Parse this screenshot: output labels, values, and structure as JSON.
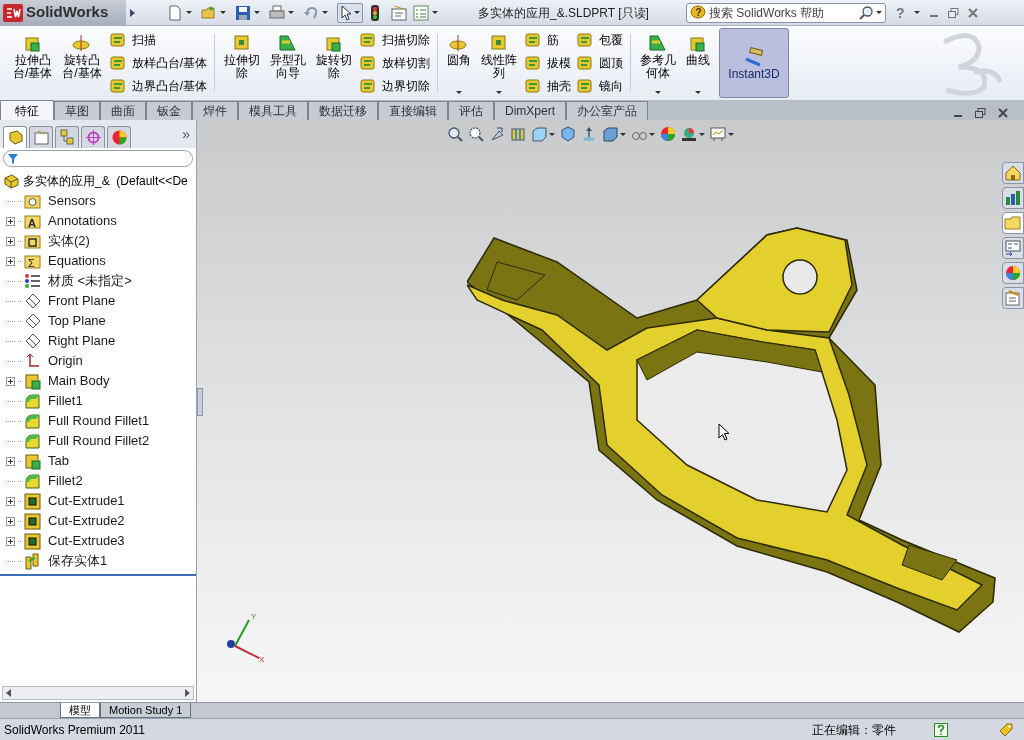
{
  "app": {
    "logo": "SolidWorks",
    "title": "多实体的应用_&.SLDPRT [只读]",
    "search": {
      "badge": "?",
      "placeholder": "搜索 SolidWorks 帮助"
    },
    "help": "?"
  },
  "ribbon": [
    {
      "kind": "large",
      "lines": [
        "拉伸凸",
        "台/基体"
      ],
      "dropdown": false,
      "selected": false
    },
    {
      "kind": "large",
      "lines": [
        "旋转凸",
        "台/基体"
      ],
      "dropdown": false,
      "selected": false
    },
    {
      "kind": "stack",
      "items": [
        "扫描",
        "放样凸台/基体",
        "边界凸台/基体"
      ]
    },
    {
      "kind": "separator"
    },
    {
      "kind": "large",
      "lines": [
        "拉伸切",
        "除"
      ],
      "dropdown": false,
      "selected": false
    },
    {
      "kind": "large",
      "lines": [
        "异型孔",
        "向导"
      ],
      "dropdown": false,
      "selected": false
    },
    {
      "kind": "large",
      "lines": [
        "旋转切",
        "除"
      ],
      "dropdown": false,
      "selected": false
    },
    {
      "kind": "stack",
      "items": [
        "扫描切除",
        "放样切割",
        "边界切除"
      ]
    },
    {
      "kind": "separator"
    },
    {
      "kind": "large",
      "lines": [
        "圆角"
      ],
      "dropdown": true,
      "selected": false
    },
    {
      "kind": "large",
      "lines": [
        "线性阵",
        "列"
      ],
      "dropdown": true,
      "selected": false
    },
    {
      "kind": "stack",
      "items": [
        "筋",
        "拔模",
        "抽壳"
      ]
    },
    {
      "kind": "stack",
      "items": [
        "包覆",
        "圆顶",
        "镜向"
      ]
    },
    {
      "kind": "separator"
    },
    {
      "kind": "large",
      "lines": [
        "参考几",
        "何体"
      ],
      "dropdown": true,
      "selected": false
    },
    {
      "kind": "large",
      "lines": [
        "曲线"
      ],
      "dropdown": true,
      "selected": false
    },
    {
      "kind": "large",
      "lines": [
        "Instant3D"
      ],
      "dropdown": false,
      "selected": true
    }
  ],
  "tabs": [
    {
      "label": "特征",
      "selected": true
    },
    {
      "label": "草图",
      "selected": false
    },
    {
      "label": "曲面",
      "selected": false
    },
    {
      "label": "钣金",
      "selected": false
    },
    {
      "label": "焊件",
      "selected": false
    },
    {
      "label": "模具工具",
      "selected": false
    },
    {
      "label": "数据迁移",
      "selected": false
    },
    {
      "label": "直接编辑",
      "selected": false
    },
    {
      "label": "评估",
      "selected": false
    },
    {
      "label": "DimXpert",
      "selected": false
    },
    {
      "label": "办公室产品",
      "selected": false
    }
  ],
  "panel": {
    "tabs": [
      {
        "selected": true
      },
      {
        "selected": false
      },
      {
        "selected": false
      },
      {
        "selected": false
      },
      {
        "selected": false
      }
    ],
    "more": "»",
    "tree": {
      "label": "多实体的应用_&  (Default<<De",
      "children": [
        {
          "label": "Sensors",
          "kind": "sensor",
          "expandable": false
        },
        {
          "label": "Annotations",
          "kind": "annotation",
          "badge": "A",
          "expandable": true
        },
        {
          "label": "实体(2)",
          "kind": "bodies",
          "expandable": true
        },
        {
          "label": "Equations",
          "kind": "equation",
          "badge": "Σ",
          "expandable": true
        },
        {
          "label": "材质 <未指定>",
          "kind": "material",
          "expandable": false
        },
        {
          "label": "Front Plane",
          "kind": "plane",
          "expandable": false
        },
        {
          "label": "Top Plane",
          "kind": "plane",
          "expandable": false
        },
        {
          "label": "Right Plane",
          "kind": "plane",
          "expandable": false
        },
        {
          "label": "Origin",
          "kind": "origin",
          "expandable": false
        },
        {
          "label": "Main Body",
          "kind": "boss",
          "expandable": true
        },
        {
          "label": "Fillet1",
          "kind": "fillet",
          "expandable": false
        },
        {
          "label": "Full Round Fillet1",
          "kind": "fillet",
          "expandable": false
        },
        {
          "label": "Full Round Fillet2",
          "kind": "fillet",
          "expandable": false
        },
        {
          "label": "Tab",
          "kind": "boss",
          "expandable": true
        },
        {
          "label": "Fillet2",
          "kind": "fillet",
          "expandable": false
        },
        {
          "label": "Cut-Extrude1",
          "kind": "cut",
          "expandable": true
        },
        {
          "label": "Cut-Extrude2",
          "kind": "cut",
          "expandable": true
        },
        {
          "label": "Cut-Extrude3",
          "kind": "cut",
          "expandable": true
        },
        {
          "label": "保存实体1",
          "kind": "save",
          "expandable": false
        }
      ]
    }
  },
  "viewport": {
    "triad": {
      "y": "Y",
      "x": "X"
    },
    "task_pane": [
      {
        "selected": false
      },
      {
        "selected": false
      },
      {
        "selected": true
      },
      {
        "selected": false
      },
      {
        "selected": false
      },
      {
        "selected": false
      }
    ]
  },
  "bottom_tabs": [
    {
      "label": "模型",
      "selected": true
    },
    {
      "label": "Motion Study 1",
      "selected": false
    }
  ],
  "status_bar": {
    "product": "SolidWorks Premium 2011",
    "mode": "正在编辑：零件"
  }
}
